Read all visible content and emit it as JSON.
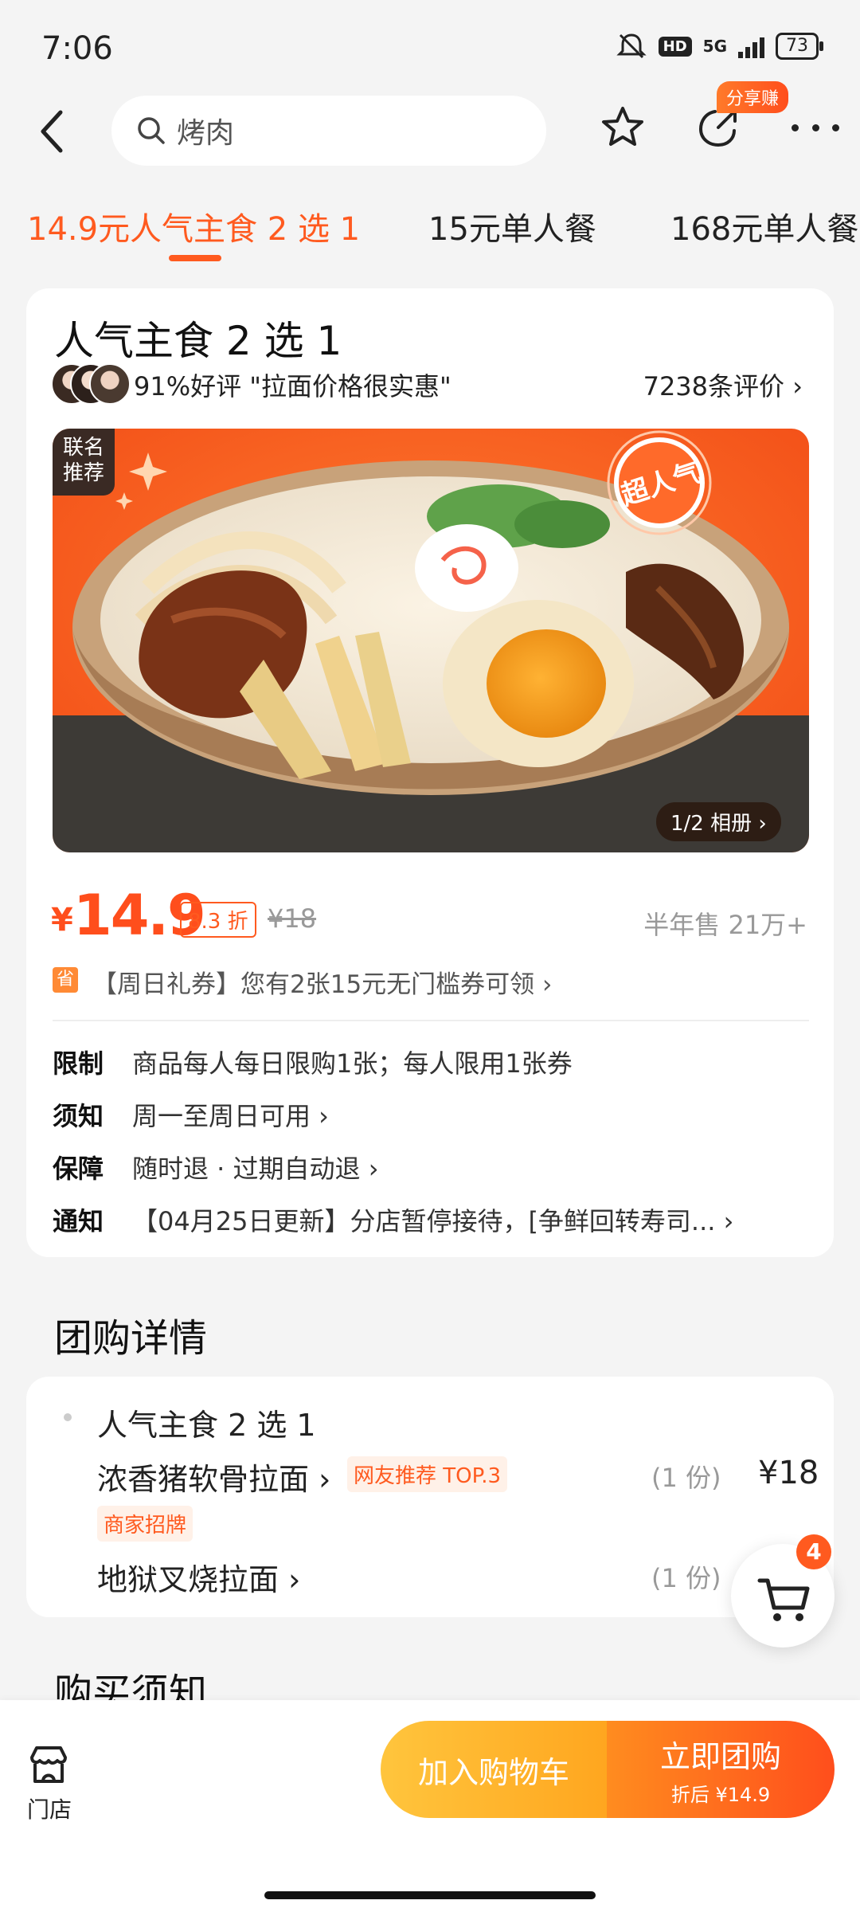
{
  "status": {
    "time": "7:06",
    "hd": "HD",
    "network": "5G",
    "battery": "73"
  },
  "header": {
    "search_value": "烤肉",
    "share_badge": "分享赚"
  },
  "tabs": [
    {
      "label": "14.9元人气主食 2 选 1",
      "active": true
    },
    {
      "label": "15元单人餐",
      "active": false
    },
    {
      "label": "168元单人餐",
      "active": false
    }
  ],
  "product": {
    "title": "人气主食 2 选 1",
    "rating": "91%好评 \"拉面价格很实惠\"",
    "reviews": "7238条评价 ›",
    "hero_tag_line1": "联名",
    "hero_tag_line2": "推荐",
    "hero_stamp": "超人气",
    "album": "1/2 相册 ›",
    "price_symbol": "¥",
    "price": "14.9",
    "discount": "8.3 折",
    "original_price": "¥18",
    "sold": "半年售 21万+"
  },
  "coupon": {
    "icon": "省",
    "text": "【周日礼券】您有2张15元无门槛券可领 ›"
  },
  "info": [
    {
      "label": "限制",
      "value": "商品每人每日限购1张；每人限用1张券"
    },
    {
      "label": "须知",
      "value": "周一至周日可用 ›"
    },
    {
      "label": "保障",
      "value": "随时退 · 过期自动退 ›"
    },
    {
      "label": "通知",
      "value": "【04月25日更新】分店暂停接待，[争鲜回转寿司... ›"
    }
  ],
  "group_detail": {
    "section_title": "团购详情",
    "title": "人气主食 2 选 1",
    "items": [
      {
        "name": "浓香猪软骨拉面 ›",
        "tag": "网友推荐 TOP.3",
        "tag2": "商家招牌",
        "qty": "(1 份)",
        "price": "¥18"
      },
      {
        "name": "地狱叉烧拉面 ›",
        "qty": "(1 份)"
      }
    ]
  },
  "cart_badge": "4",
  "purchase_notice_title": "购买须知",
  "bottom": {
    "store_label": "门店",
    "add_cart": "加入购物车",
    "buy_now": "立即团购",
    "buy_sub": "折后 ¥14.9"
  },
  "colors": {
    "accent": "#ff5a1f",
    "cart_button": "#ffb22e",
    "background": "#f4f4f4"
  }
}
